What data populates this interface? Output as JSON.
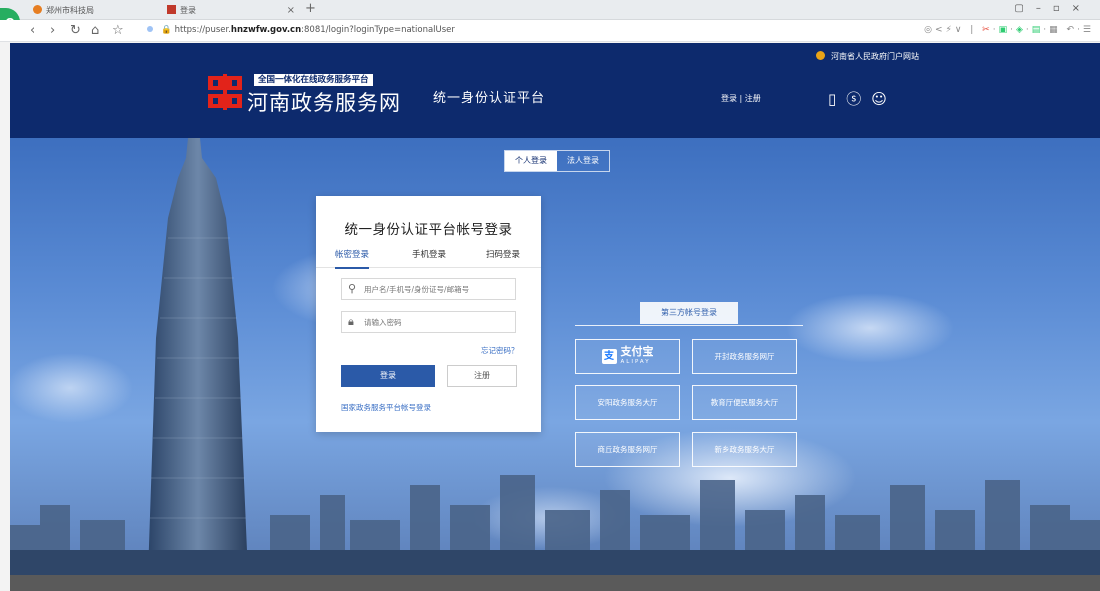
{
  "browser": {
    "tabs": [
      {
        "title": "郑州市科技局"
      },
      {
        "title": "登录"
      }
    ],
    "url_prefix": "https://puser.",
    "url_host": "hnzwfw.gov.cn",
    "url_suffix": ":8081/login?loginType=nationalUser"
  },
  "header": {
    "portal_link": "河南省人民政府门户网站",
    "logo_badge": "全国一体化在线政务服务平台",
    "logo_name": "河南政务服务网",
    "platform_title": "统一身份认证平台",
    "login_links": "登录 | 注册"
  },
  "login_type": {
    "personal": "个人登录",
    "legal": "法人登录"
  },
  "card": {
    "title": "统一身份认证平台帐号登录",
    "tabs": [
      "帐密登录",
      "手机登录",
      "扫码登录"
    ],
    "username_placeholder": "用户名/手机号/身份证号/邮箱号",
    "password_placeholder": "请输入密码",
    "forgot": "忘记密码？",
    "login_btn": "登录",
    "register_btn": "注册",
    "national_link": "国家政务服务平台帐号登录"
  },
  "third_party": {
    "title": "第三方帐号登录",
    "alipay": "支付宝",
    "alipay_sub": "ALIPAY",
    "buttons": [
      "开封政务服务网厅",
      "安阳政务服务大厅",
      "教育厅便民服务大厅",
      "商丘政务服务网厅",
      "新乡政务服务大厅"
    ]
  }
}
